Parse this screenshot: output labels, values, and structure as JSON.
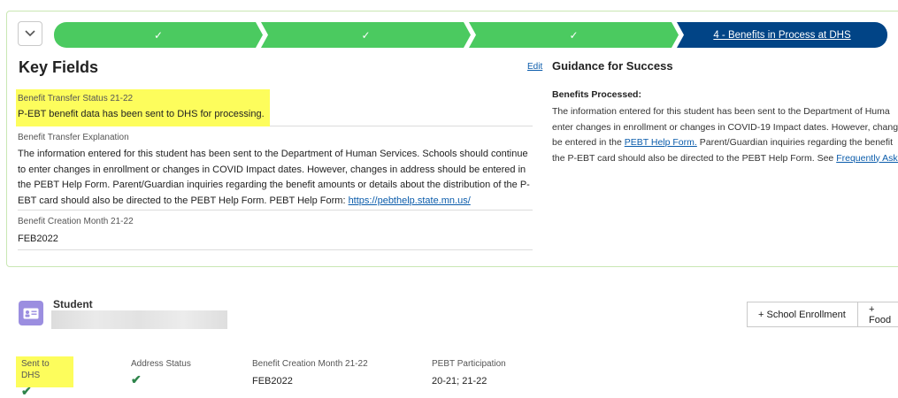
{
  "path": {
    "steps": [
      {
        "state": "complete",
        "label": ""
      },
      {
        "state": "complete",
        "label": ""
      },
      {
        "state": "complete",
        "label": ""
      },
      {
        "state": "current",
        "label": "4 - Benefits in Process at DHS"
      }
    ]
  },
  "key_fields": {
    "title": "Key Fields",
    "edit_label": "Edit",
    "fields": [
      {
        "label": "Benefit Transfer Status 21-22",
        "value": "P-EBT benefit data has been sent to DHS for processing."
      },
      {
        "label": "Benefit Transfer Explanation",
        "value": "The information entered for this student has been sent to the Department of Human Services. Schools should continue to enter changes in enrollment or changes in COVID Impact dates. However, changes in address should be entered in the PEBT Help Form. Parent/Guardian inquiries regarding the benefit amounts or details about the distribution of the P-EBT card should also be directed to the PEBT Help Form. PEBT Help Form: ",
        "link": "https://pebthelp.state.mn.us/"
      },
      {
        "label": "Benefit Creation Month 21-22",
        "value": "FEB2022"
      }
    ]
  },
  "guidance": {
    "title": "Guidance for Success",
    "subtitle": "Benefits Processed:",
    "body_1": "The information entered for this student has been sent to the Department of Huma",
    "body_2": "enter changes in enrollment or changes in COVID-19 Impact dates. However, chang",
    "body_3_pre": "be entered in the ",
    "body_3_link": "PEBT Help Form.",
    "body_3_post": " Parent/Guardian inquiries regarding the benefit",
    "body_4_pre": "the P-EBT card should also be directed to the PEBT Help Form. See ",
    "body_4_link": "Frequently Aske"
  },
  "student": {
    "label": "Student",
    "buttons": [
      "+ School Enrollment",
      "+ Food"
    ],
    "columns": [
      {
        "label": "Sent to DHS",
        "value": "",
        "check": true
      },
      {
        "label": "Address Status",
        "value": "",
        "check": true
      },
      {
        "label": "Benefit Creation Month 21-22",
        "value": "FEB2022",
        "check": false
      },
      {
        "label": "PEBT Participation",
        "value": "20-21; 21-22",
        "check": false
      }
    ]
  },
  "colors": {
    "complete": "#4bca60",
    "current": "#014486",
    "highlight": "#fdfd5c",
    "check": "#2e844a"
  }
}
